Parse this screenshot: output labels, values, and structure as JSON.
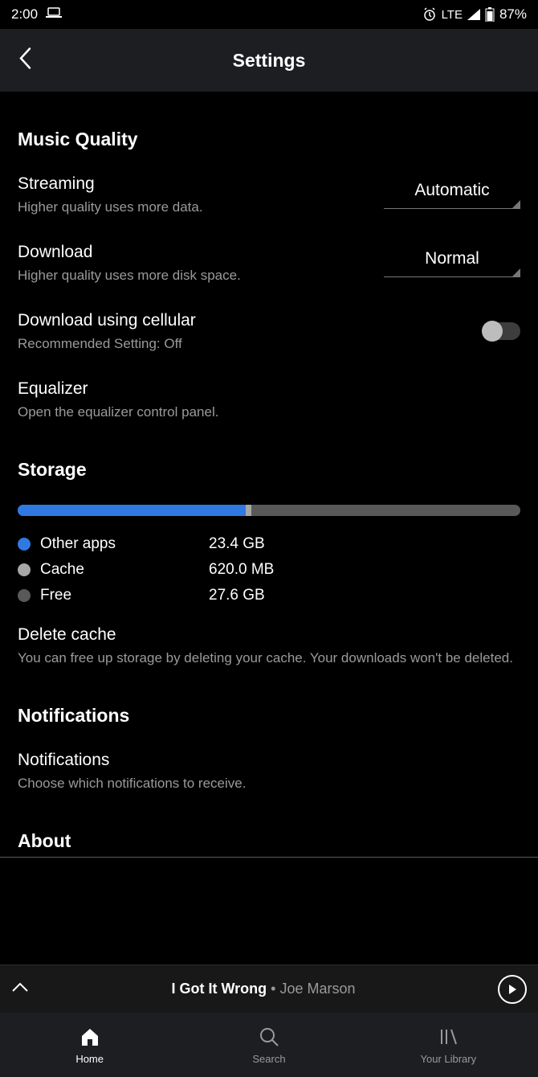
{
  "status_bar": {
    "time": "2:00",
    "network": "LTE",
    "battery": "87%"
  },
  "header": {
    "title": "Settings"
  },
  "sections": {
    "music_quality": {
      "title": "Music Quality",
      "streaming": {
        "label": "Streaming",
        "desc": "Higher quality uses more data.",
        "value": "Automatic"
      },
      "download": {
        "label": "Download",
        "desc": "Higher quality uses more disk space.",
        "value": "Normal"
      },
      "cellular": {
        "label": "Download using cellular",
        "desc": "Recommended Setting: Off",
        "value": false
      },
      "equalizer": {
        "label": "Equalizer",
        "desc": "Open the equalizer control panel."
      }
    },
    "storage": {
      "title": "Storage",
      "segments": {
        "other_apps": {
          "label": "Other apps",
          "value": "23.4 GB",
          "percent": 45.3
        },
        "cache": {
          "label": "Cache",
          "value": "620.0 MB",
          "percent": 1.2
        },
        "free": {
          "label": "Free",
          "value": "27.6 GB",
          "percent": 53.5
        }
      },
      "delete_cache": {
        "label": "Delete cache",
        "desc": "You can free up storage by deleting your cache. Your downloads won't be deleted."
      }
    },
    "notifications": {
      "title": "Notifications",
      "item": {
        "label": "Notifications",
        "desc": "Choose which notifications to receive."
      }
    },
    "about": {
      "title": "About"
    }
  },
  "now_playing": {
    "title": "I Got It Wrong",
    "artist": "Joe Marson",
    "separator": " • "
  },
  "bottom_nav": {
    "home": "Home",
    "search": "Search",
    "library": "Your Library"
  }
}
